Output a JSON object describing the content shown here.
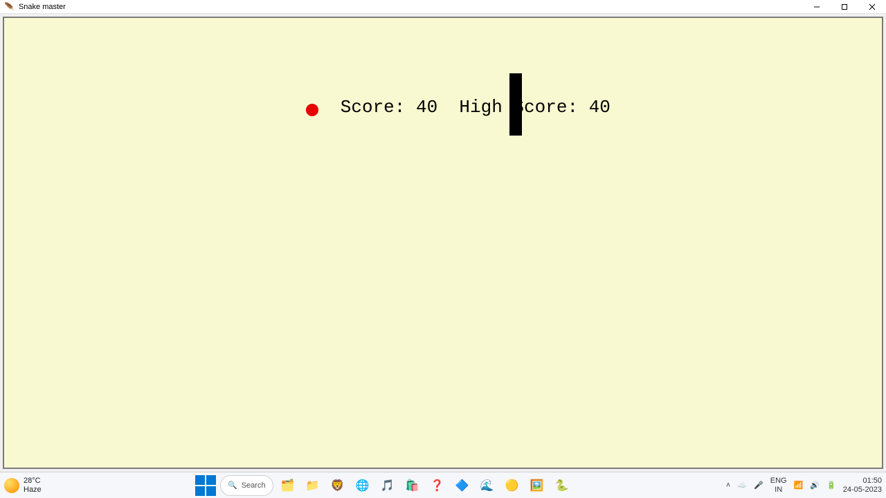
{
  "window": {
    "title": "Snake master"
  },
  "game": {
    "score_label": "Score: ",
    "score_value": "40",
    "highscore_label": "High Score: ",
    "highscore_value": "40",
    "sep": "  "
  },
  "taskbar": {
    "weather_temp": "28°C",
    "weather_cond": "Haze",
    "search_placeholder": "Search",
    "lang_top": "ENG",
    "lang_bot": "IN",
    "time": "01:50",
    "date": "24-05-2023"
  }
}
